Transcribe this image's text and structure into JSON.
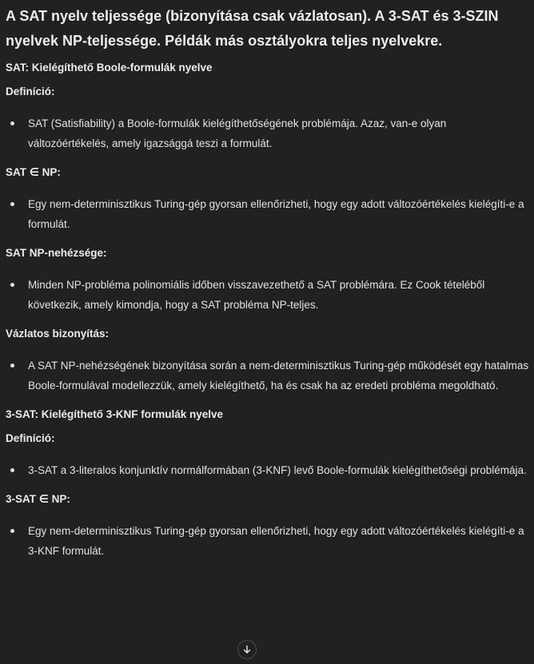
{
  "title": "A SAT nyelv teljessége (bizonyítása csak vázlatosan). A 3-SAT és 3-SZIN nyelvek NP-teljessége. Példák más osztályokra teljes nyelvekre.",
  "sections": [
    {
      "heading": "SAT: Kielégíthető Boole-formulák nyelve",
      "definition_label": "Definíció:",
      "definition_item": "SAT (Satisfiability) a Boole-formulák kielégíthetőségének problémája. Azaz, van-e olyan változóértékelés, amely igazsággá teszi a formulát.",
      "in_np_label": "SAT ∈ NP:",
      "in_np_item": "Egy nem-determinisztikus Turing-gép gyorsan ellenőrizheti, hogy egy adott változóértékelés kielégíti-e a formulát.",
      "np_hard_label": "SAT NP-nehézsége:",
      "np_hard_item": "Minden NP-probléma polinomiális időben visszavezethető a SAT problémára. Ez Cook tételéből következik, amely kimondja, hogy a SAT probléma NP-teljes.",
      "proof_label": "Vázlatos bizonyítás:",
      "proof_item": "A SAT NP-nehézségének bizonyítása során a nem-determinisztikus Turing-gép működését egy hatalmas Boole-formulával modellezzük, amely kielégíthető, ha és csak ha az eredeti probléma megoldható."
    },
    {
      "heading": "3-SAT: Kielégíthető 3-KNF formulák nyelve",
      "definition_label": "Definíció:",
      "definition_item": "3-SAT a 3-literalos konjunktív normálformában (3-KNF) levő Boole-formulák kielégíthetőségi problémája.",
      "in_np_label": "3-SAT ∈ NP:",
      "in_np_item": "Egy nem-determinisztikus Turing-gép gyorsan ellenőrizheti, hogy egy adott változóértékelés kielégíti-e a 3-KNF formulát."
    }
  ],
  "icons": {
    "scroll_down": "arrow-down-icon"
  }
}
